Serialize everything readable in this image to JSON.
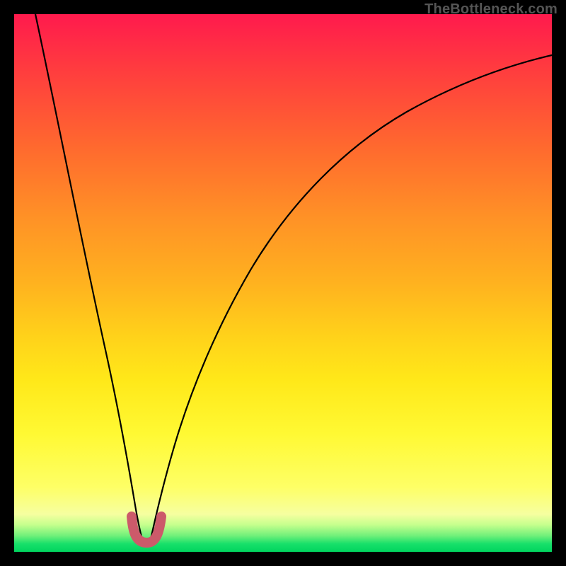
{
  "watermark": {
    "text": "TheBottleneck.com"
  },
  "colors": {
    "frame": "#000000",
    "gradient_top": "#ff1a4d",
    "gradient_mid": "#ffd21a",
    "gradient_bottom": "#00d45e",
    "curve": "#000000",
    "u_marker": "#cc5a6a"
  },
  "chart_data": {
    "type": "line",
    "title": "",
    "xlabel": "",
    "ylabel": "",
    "x_range": [
      0,
      100
    ],
    "y_range_percent_bottleneck": [
      0,
      100
    ],
    "background": "heatmap-gradient (red high, green low)",
    "notch_center_x": 23.5,
    "series": [
      {
        "name": "left-branch",
        "x": [
          4,
          6,
          8,
          10,
          12,
          14,
          16,
          18,
          20,
          21,
          22,
          23
        ],
        "y_pct": [
          100,
          90,
          80,
          69,
          58,
          47,
          36,
          25,
          14,
          9,
          5,
          2
        ]
      },
      {
        "name": "right-branch",
        "x": [
          24,
          25,
          26,
          28,
          30,
          33,
          36,
          40,
          45,
          50,
          56,
          62,
          70,
          78,
          86,
          94,
          100
        ],
        "y_pct": [
          2,
          5,
          9,
          16,
          23,
          32,
          40,
          48,
          56,
          62,
          68,
          72,
          77,
          80,
          83,
          85,
          87
        ]
      },
      {
        "name": "u-marker",
        "x": [
          21.5,
          22,
          23,
          24,
          25,
          25.5
        ],
        "y_pct": [
          6,
          3,
          1.5,
          1.5,
          3,
          6
        ]
      }
    ],
    "legend": []
  }
}
